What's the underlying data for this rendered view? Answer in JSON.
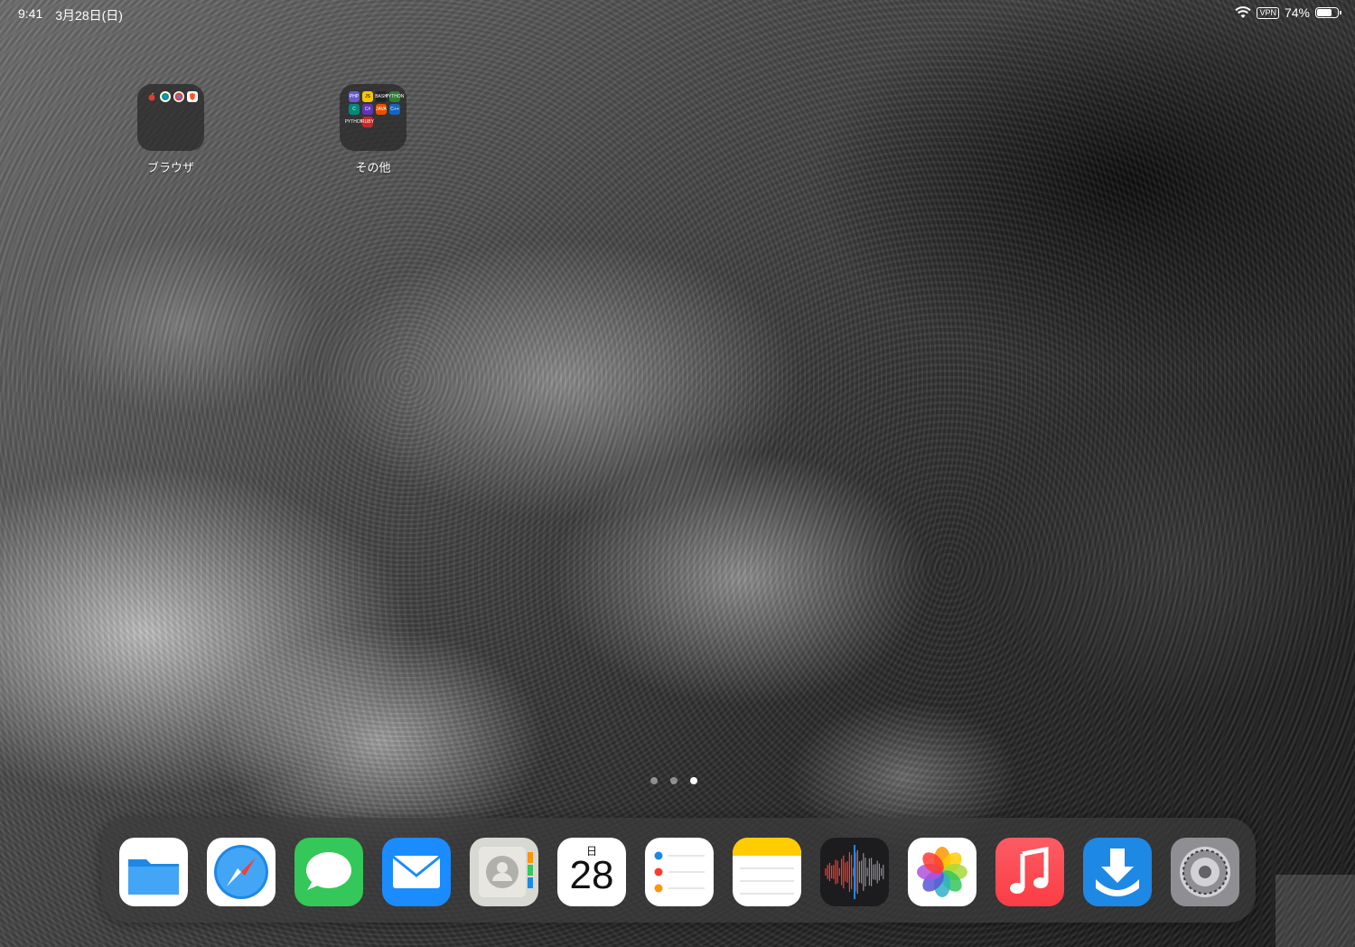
{
  "status_bar": {
    "time": "9:41",
    "date": "3月28日(日)",
    "vpn": "VPN",
    "battery": "74%",
    "battery_level": 0.74
  },
  "folders": [
    {
      "label": "ブラウザ"
    },
    {
      "label": "その他",
      "mini_labels": [
        "PHP",
        "JS",
        "BASH",
        "PYTHON",
        "C",
        "C#",
        "JAVA",
        "C++",
        "PYTHON",
        "RUBY"
      ]
    }
  ],
  "page_dots": {
    "count": 3,
    "active_index": 2
  },
  "dock": {
    "apps": [
      {
        "name": "Files",
        "icon": "files-icon"
      },
      {
        "name": "Safari",
        "icon": "safari-icon"
      },
      {
        "name": "Messages",
        "icon": "messages-icon"
      },
      {
        "name": "Mail",
        "icon": "mail-icon"
      },
      {
        "name": "Contacts",
        "icon": "contacts-icon"
      },
      {
        "name": "Calendar",
        "icon": "calendar-icon",
        "weekday": "日",
        "day": "28"
      },
      {
        "name": "Reminders",
        "icon": "reminders-icon"
      },
      {
        "name": "Notes",
        "icon": "notes-icon"
      },
      {
        "name": "Voice Memos",
        "icon": "voice-memos-icon"
      },
      {
        "name": "Photos",
        "icon": "photos-icon"
      },
      {
        "name": "Music",
        "icon": "music-icon"
      },
      {
        "name": "Downloader",
        "icon": "download-icon"
      },
      {
        "name": "Settings",
        "icon": "settings-icon"
      }
    ]
  },
  "colors": {
    "messages": "#34c759",
    "mail": "#1a8cff",
    "music": "#fc3c44",
    "download": "#1e88e5"
  }
}
